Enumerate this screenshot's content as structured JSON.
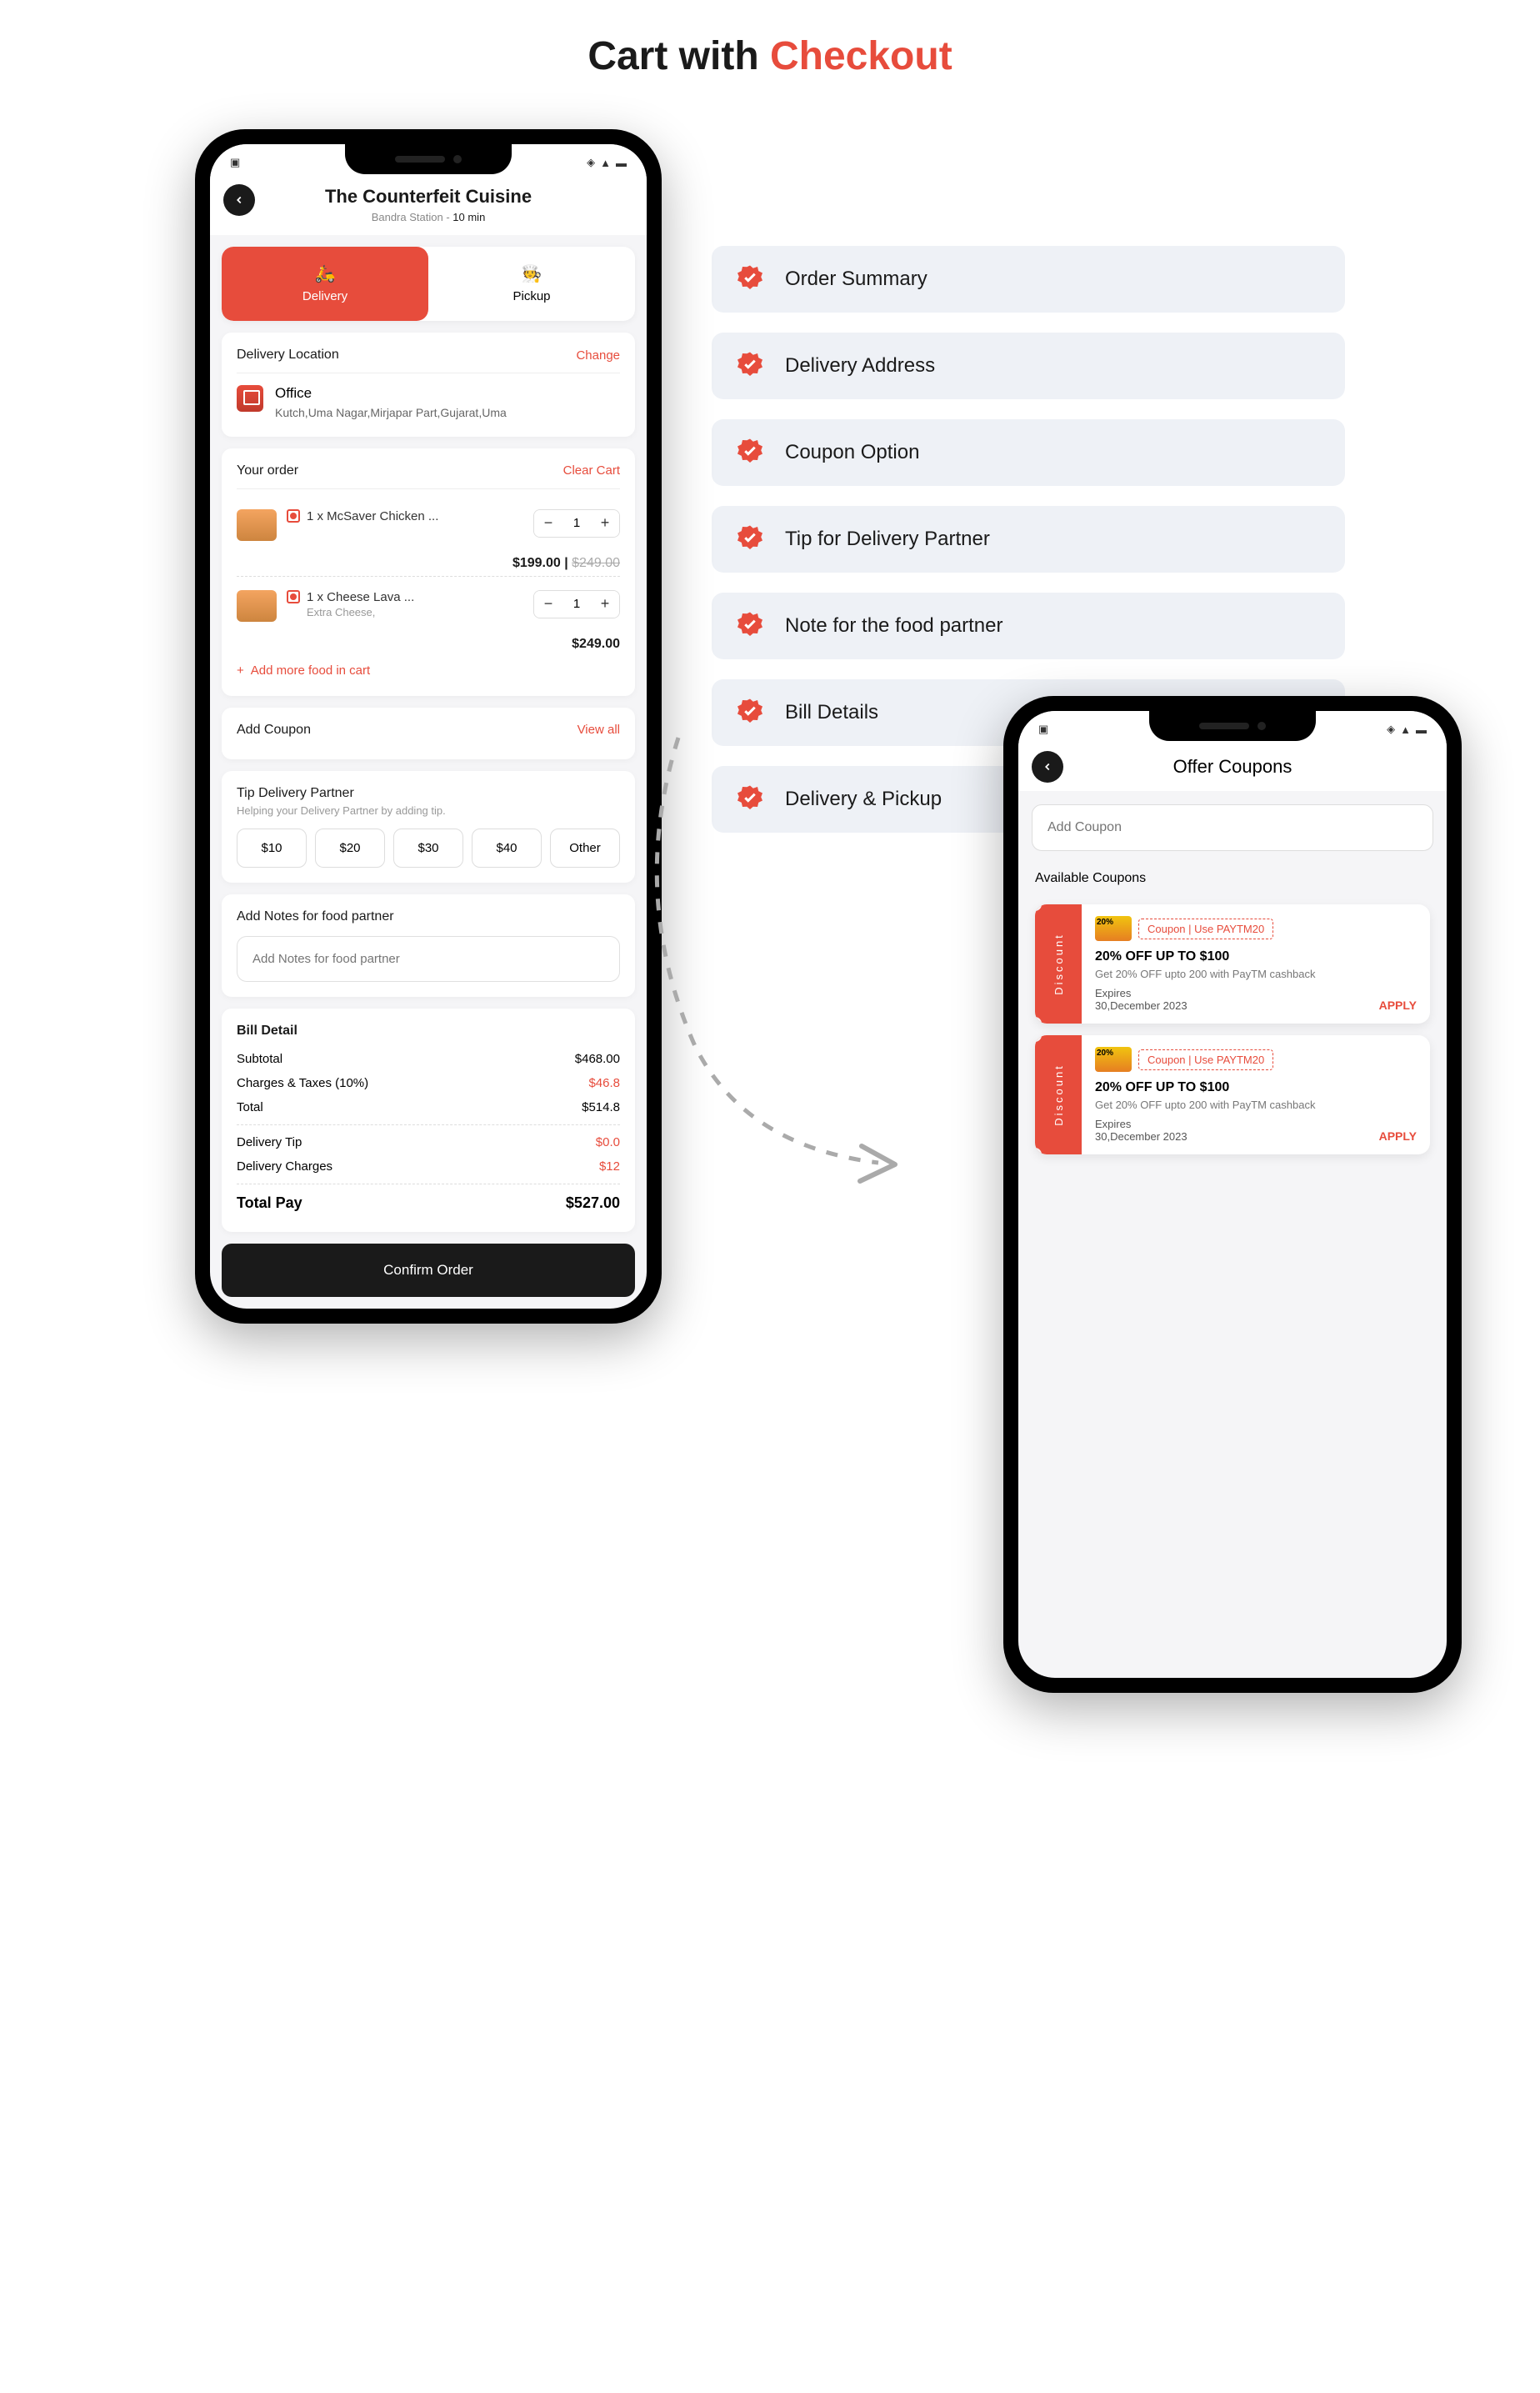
{
  "pageTitle": {
    "main": "Cart with ",
    "accent": "Checkout"
  },
  "features": [
    "Order Summary",
    "Delivery Address",
    "Coupon Option",
    "Tip for Delivery Partner",
    "Note for the food partner",
    "Bill Details",
    "Delivery & Pickup"
  ],
  "cart": {
    "restaurant": "The Counterfeit Cuisine",
    "subLocation": "Bandra Station",
    "eta": "10 min",
    "tabs": {
      "delivery": "Delivery",
      "pickup": "Pickup"
    },
    "location": {
      "section": "Delivery Location",
      "change": "Change",
      "name": "Office",
      "address": "Kutch,Uma Nagar,Mirjapar Part,Gujarat,Uma"
    },
    "order": {
      "section": "Your order",
      "clear": "Clear Cart",
      "items": [
        {
          "name": "1 x McSaver Chicken ...",
          "qty": "1",
          "price": "$199.00",
          "old": "$249.00",
          "extra": ""
        },
        {
          "name": "1 x Cheese Lava ...",
          "qty": "1",
          "price": "$249.00",
          "old": "",
          "extra": "Extra Cheese,"
        }
      ],
      "addMore": "Add more food in cart"
    },
    "coupon": {
      "section": "Add Coupon",
      "viewAll": "View all"
    },
    "tip": {
      "section": "Tip Delivery Partner",
      "sub": "Helping your Delivery Partner by adding tip.",
      "options": [
        "$10",
        "$20",
        "$30",
        "$40",
        "Other"
      ]
    },
    "notes": {
      "section": "Add Notes for food partner",
      "placeholder": "Add Notes for food partner"
    },
    "bill": {
      "section": "Bill Detail",
      "rows": [
        {
          "label": "Subtotal",
          "value": "$468.00",
          "red": false
        },
        {
          "label": "Charges & Taxes (10%)",
          "value": "$46.8",
          "red": true
        },
        {
          "label": "Total",
          "value": "$514.8",
          "red": false
        },
        {
          "label": "Delivery Tip",
          "value": "$0.0",
          "red": true
        },
        {
          "label": "Delivery Charges",
          "value": "$12",
          "red": true
        }
      ],
      "total": {
        "label": "Total Pay",
        "value": "$527.00"
      }
    },
    "confirm": "Confirm Order"
  },
  "coupons": {
    "title": "Offer Coupons",
    "placeholder": "Add Coupon",
    "available": "Available Coupons",
    "sideLabel": "Discount",
    "list": [
      {
        "code": "Coupon | Use  PAYTM20",
        "name": "20% OFF UP TO $100",
        "desc": "Get 20% OFF upto 200 with PayTM cashback",
        "expLabel": "Expires",
        "exp": "30,December 2023",
        "apply": "APPLY"
      },
      {
        "code": "Coupon | Use  PAYTM20",
        "name": "20% OFF UP TO $100",
        "desc": "Get 20% OFF upto 200 with PayTM cashback",
        "expLabel": "Expires",
        "exp": "30,December 2023",
        "apply": "APPLY"
      }
    ]
  }
}
